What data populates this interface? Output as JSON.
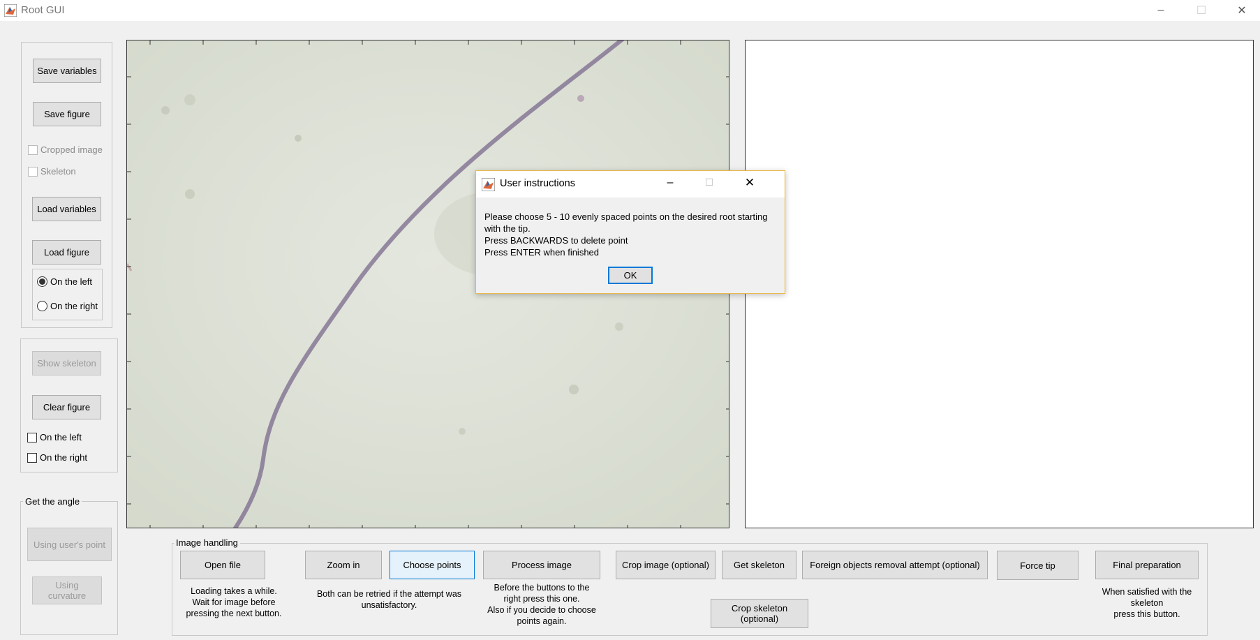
{
  "window": {
    "title": "Root GUI",
    "icon": "matlab-icon",
    "controls": [
      "–",
      "☐",
      "✕"
    ]
  },
  "left_panel": {
    "save_variables": "Save variables",
    "save_figure": "Save figure",
    "cropped_image": "Cropped image",
    "skeleton": "Skeleton",
    "load_variables": "Load variables",
    "load_figure": "Load figure",
    "on_the_left": "On the left",
    "on_the_right": "On the right",
    "radio_selected": "On the left"
  },
  "skeleton_panel": {
    "show_skeleton": "Show skeleton",
    "clear_figure": "Clear figure",
    "on_the_left": "On the left",
    "on_the_right": "On the right"
  },
  "angle_panel": {
    "title": "Get the angle",
    "using_users_point": "Using user's point",
    "using_curvature": "Using curvature"
  },
  "image_panel": {
    "title": "Image handling",
    "open_file": "Open file",
    "open_file_desc": "Loading takes a while.\nWait for  image before\npressing the next button.",
    "zoom_in": "Zoom in",
    "choose_points": "Choose points",
    "retry_desc": "Both can be retried if the attempt was\nunsatisfactory.",
    "process_image": "Process image",
    "process_desc": "Before the buttons to the\nright press this one.\nAlso if you decide to choose\npoints again.",
    "crop_image": "Crop image (optional)",
    "get_skeleton": "Get skeleton",
    "foreign_objects": "Foreign objects removal attempt (optional)",
    "crop_skeleton": "Crop skeleton (optional)",
    "force_tip": "Force tip",
    "final_preparation": "Final preparation",
    "final_desc": "When satisfied with the\nskeleton\npress this button."
  },
  "dialog": {
    "title": "User instructions",
    "icon": "matlab-icon",
    "line1": "Please choose 5 - 10 evenly spaced points on the desired root starting",
    "line2": "with the tip.",
    "line3": "Press BACKWARDS to delete point",
    "line4": "Press ENTER when finished",
    "ok": "OK",
    "controls": [
      "–",
      "☐",
      "✕"
    ]
  },
  "colors": {
    "background": "#f0f0f0",
    "image_background": "#dfe3d8",
    "root_color": "#7a6a8c",
    "dialog_border": "#e8b84a",
    "focus_blue": "#0078d7"
  }
}
